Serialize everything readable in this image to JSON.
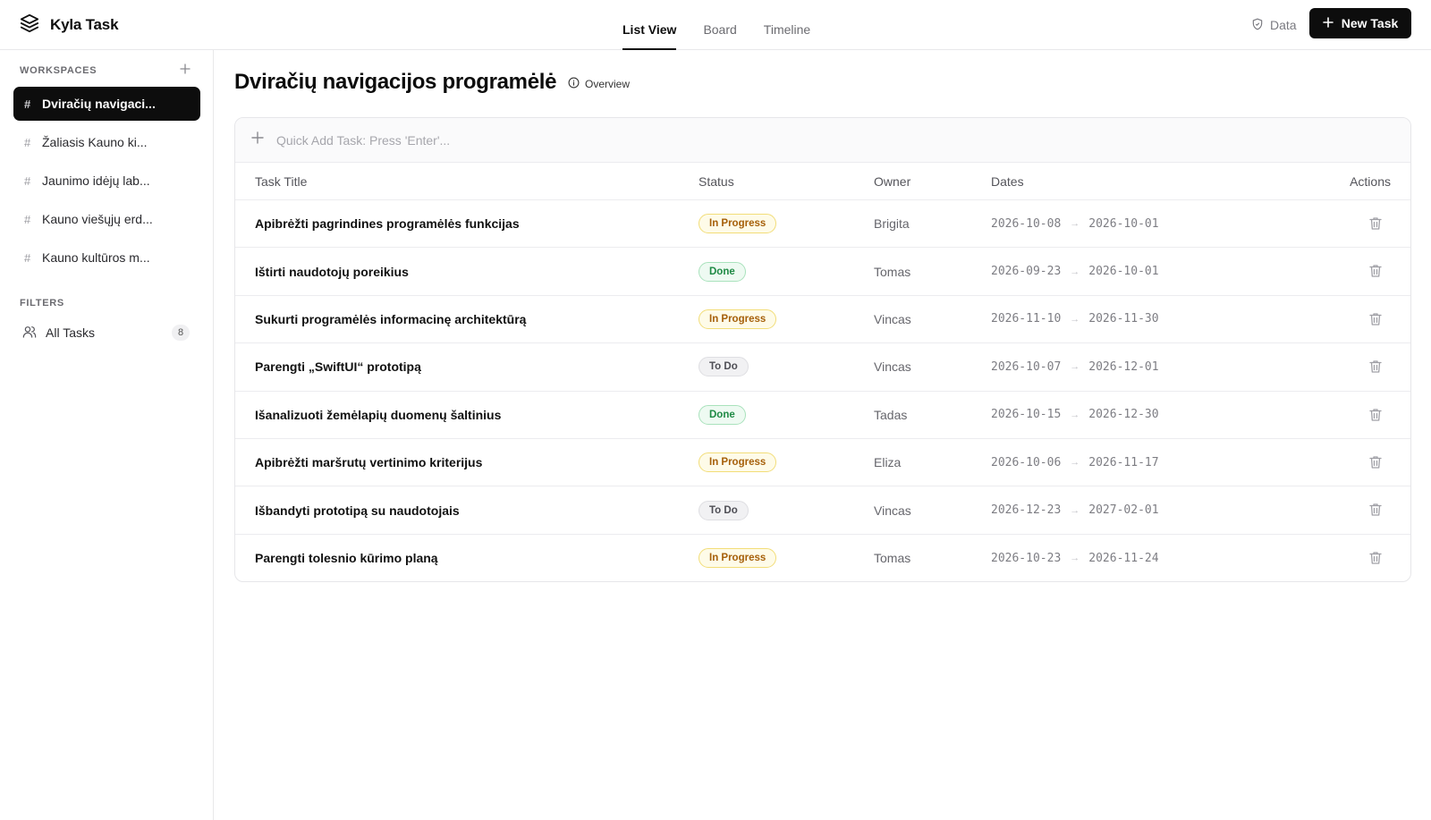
{
  "app": {
    "name": "Kyla Task",
    "logo_icon": "layers-icon"
  },
  "header": {
    "tabs": [
      {
        "label": "List View",
        "active": true
      },
      {
        "label": "Board",
        "active": false
      },
      {
        "label": "Timeline",
        "active": false
      }
    ],
    "data_link": {
      "label": "Data",
      "icon": "shield-icon"
    },
    "new_task_button": {
      "label": "New Task",
      "icon": "plus-icon"
    }
  },
  "sidebar": {
    "workspaces_label": "WORKSPACES",
    "workspaces": [
      {
        "label": "Dviračių navigaci...",
        "active": true
      },
      {
        "label": "Žaliasis Kauno ki...",
        "active": false
      },
      {
        "label": "Jaunimo idėjų lab...",
        "active": false
      },
      {
        "label": "Kauno viešųjų erd...",
        "active": false
      },
      {
        "label": "Kauno kultūros m...",
        "active": false
      }
    ],
    "filters_label": "FILTERS",
    "filters": [
      {
        "label": "All Tasks",
        "count": "8",
        "icon": "users-icon"
      }
    ]
  },
  "main": {
    "title": "Dviračių navigacijos programėlė",
    "overview_label": "Overview",
    "quick_add_placeholder": "Quick Add Task: Press 'Enter'...",
    "columns": {
      "title": "Task Title",
      "status": "Status",
      "owner": "Owner",
      "dates": "Dates",
      "actions": "Actions"
    },
    "tasks": [
      {
        "title": "Apibrėžti pagrindines programėlės funkcijas",
        "status": "In Progress",
        "owner": "Brigita",
        "start": "2026-10-08",
        "end": "2026-10-01"
      },
      {
        "title": "Ištirti naudotojų poreikius",
        "status": "Done",
        "owner": "Tomas",
        "start": "2026-09-23",
        "end": "2026-10-01"
      },
      {
        "title": "Sukurti programėlės informacinę architektūrą",
        "status": "In Progress",
        "owner": "Vincas",
        "start": "2026-11-10",
        "end": "2026-11-30"
      },
      {
        "title": "Parengti „SwiftUI“ prototipą",
        "status": "To Do",
        "owner": "Vincas",
        "start": "2026-10-07",
        "end": "2026-12-01"
      },
      {
        "title": "Išanalizuoti žemėlapių duomenų šaltinius",
        "status": "Done",
        "owner": "Tadas",
        "start": "2026-10-15",
        "end": "2026-12-30"
      },
      {
        "title": "Apibrėžti maršrutų vertinimo kriterijus",
        "status": "In Progress",
        "owner": "Eliza",
        "start": "2026-10-06",
        "end": "2026-11-17"
      },
      {
        "title": "Išbandyti prototipą su naudotojais",
        "status": "To Do",
        "owner": "Vincas",
        "start": "2026-12-23",
        "end": "2027-02-01"
      },
      {
        "title": "Parengti tolesnio kūrimo planą",
        "status": "In Progress",
        "owner": "Tomas",
        "start": "2026-10-23",
        "end": "2026-11-24"
      }
    ]
  },
  "colors": {
    "accent": "#0d0d0d",
    "in_progress": "#a6600a",
    "done": "#1f8a45",
    "todo": "#4e4e55"
  }
}
